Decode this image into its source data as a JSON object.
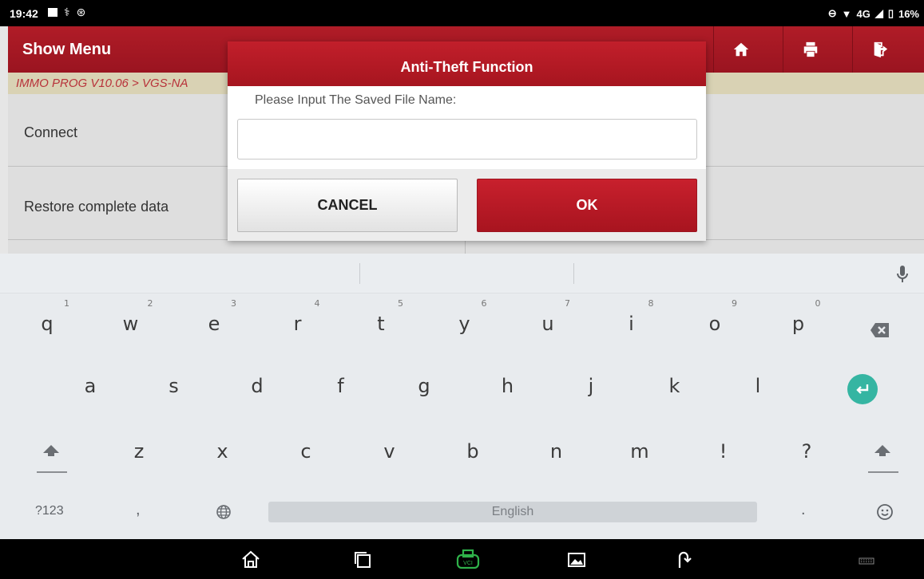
{
  "status_bar": {
    "time": "19:42",
    "battery": "16%",
    "network": "4G"
  },
  "app_header": {
    "title": "Show Menu",
    "icons": [
      "home-icon",
      "print-icon",
      "exit-icon"
    ]
  },
  "breadcrumb": "IMMO PROG V10.06 > VGS-NA",
  "menu": {
    "items": [
      {
        "label": "Connect"
      },
      {
        "label": "Restore complete data"
      }
    ]
  },
  "dialog": {
    "title": "Anti-Theft Function",
    "prompt": "Please Input The Saved File Name:",
    "input_value": "",
    "cancel_label": "CANCEL",
    "ok_label": "OK"
  },
  "keyboard": {
    "row1": [
      {
        "ch": "q",
        "num": "1"
      },
      {
        "ch": "w",
        "num": "2"
      },
      {
        "ch": "e",
        "num": "3"
      },
      {
        "ch": "r",
        "num": "4"
      },
      {
        "ch": "t",
        "num": "5"
      },
      {
        "ch": "y",
        "num": "6"
      },
      {
        "ch": "u",
        "num": "7"
      },
      {
        "ch": "i",
        "num": "8"
      },
      {
        "ch": "o",
        "num": "9"
      },
      {
        "ch": "p",
        "num": "0"
      }
    ],
    "row2": [
      "a",
      "s",
      "d",
      "f",
      "g",
      "h",
      "j",
      "k",
      "l"
    ],
    "row3": [
      "z",
      "x",
      "c",
      "v",
      "b",
      "n",
      "m",
      "!",
      "?"
    ],
    "symbols_label": "?123",
    "comma": ",",
    "period": ".",
    "space_label": "English"
  },
  "colors": {
    "accent": "#a6151f",
    "enter_key": "#35b5a2",
    "breadcrumb_text": "#b8323a"
  }
}
